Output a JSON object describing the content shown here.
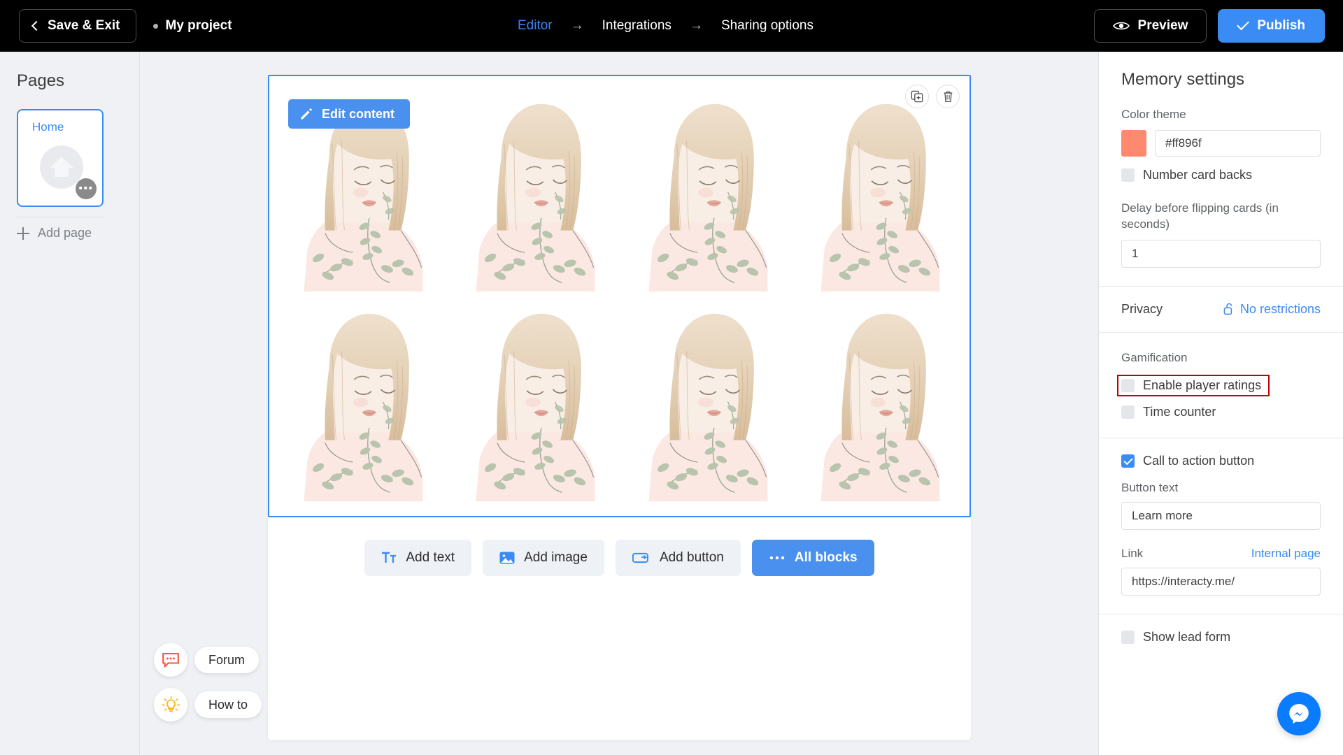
{
  "topbar": {
    "save_exit_label": "Save & Exit",
    "project_name": "My project",
    "steps": [
      {
        "label": "Editor",
        "active": true
      },
      {
        "label": "Integrations",
        "active": false
      },
      {
        "label": "Sharing options",
        "active": false
      }
    ],
    "arrow_glyph": "→",
    "preview_label": "Preview",
    "publish_label": "Publish"
  },
  "sidebar": {
    "title": "Pages",
    "page": {
      "label": "Home",
      "icon": "home-icon",
      "menu_glyph": "•••"
    },
    "add_page_label": "Add page"
  },
  "canvas": {
    "edit_content_label": "Edit content",
    "tools": [
      {
        "name": "duplicate-block-icon"
      },
      {
        "name": "delete-block-icon"
      }
    ],
    "memory_cards_count": 8,
    "grid_columns": 4,
    "grid_rows": 2,
    "card_alt": "illustration of woman with blonde bob hair and leafy vines"
  },
  "blocks_toolbar": [
    {
      "label": "Add text",
      "icon": "text-icon",
      "primary": false
    },
    {
      "label": "Add image",
      "icon": "image-icon",
      "primary": false
    },
    {
      "label": "Add button",
      "icon": "button-icon",
      "primary": false
    },
    {
      "label": "All blocks",
      "icon": "ellipsis-icon",
      "primary": true
    }
  ],
  "helpers": [
    {
      "label": "Forum",
      "icon": "chat-bubble-icon"
    },
    {
      "label": "How to",
      "icon": "lightbulb-icon"
    }
  ],
  "settings": {
    "title": "Memory settings",
    "color_theme_label": "Color theme",
    "color_theme_value": "#ff896f",
    "color_swatch_hex": "#ff896f",
    "number_card_backs_label": "Number card backs",
    "number_card_backs_checked": false,
    "delay_label": "Delay before flipping cards (in seconds)",
    "delay_value": "1",
    "privacy_label": "Privacy",
    "privacy_value": "No restrictions",
    "privacy_icon": "unlock-icon",
    "gamification_label": "Gamification",
    "enable_player_ratings_label": "Enable player ratings",
    "enable_player_ratings_checked": false,
    "time_counter_label": "Time counter",
    "time_counter_checked": false,
    "cta_label": "Call to action button",
    "cta_checked": true,
    "button_text_label": "Button text",
    "button_text_value": "Learn more",
    "link_label": "Link",
    "internal_page_label": "Internal page",
    "link_value": "https://interacty.me/",
    "show_lead_form_label": "Show lead form",
    "show_lead_form_checked": false
  },
  "fab": {
    "icon": "messenger-icon",
    "color": "#0a7cff"
  },
  "highlight": {
    "color": "#c00000",
    "target": "enable-player-ratings-row"
  }
}
